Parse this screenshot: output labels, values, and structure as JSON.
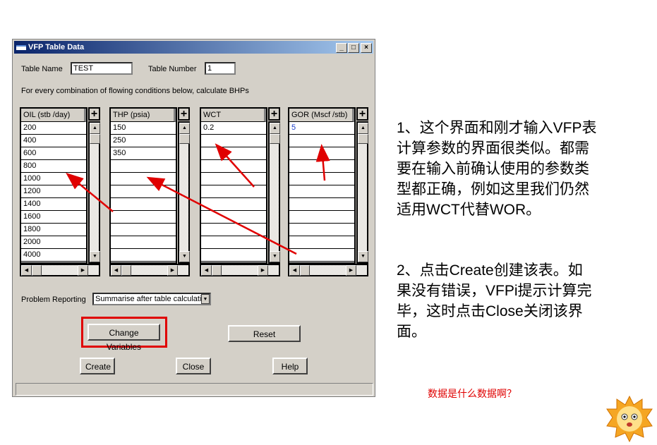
{
  "window": {
    "title": "VFP Table Data",
    "controls": [
      "_",
      "□",
      "×"
    ]
  },
  "table_name": {
    "label": "Table Name",
    "value": "TEST"
  },
  "table_number": {
    "label": "Table Number",
    "value": "1"
  },
  "instruction": "For every combination of flowing conditions below, calculate BHPs",
  "columns": [
    {
      "header": "OIL (stb /day)",
      "values": [
        "200",
        "400",
        "600",
        "800",
        "1000",
        "1200",
        "1400",
        "1600",
        "1800",
        "2000",
        "4000"
      ]
    },
    {
      "header": "THP (psia)",
      "values": [
        "150",
        "250",
        "350"
      ]
    },
    {
      "header": "WCT",
      "values": [
        "0.2"
      ]
    },
    {
      "header": "GOR (Mscf /stb)",
      "values": [
        "5"
      ]
    }
  ],
  "problem_reporting": {
    "label": "Problem Reporting",
    "value": "Summarise after table calculatio"
  },
  "buttons": {
    "change_variables": "Change Variables",
    "reset": "Reset",
    "create": "Create",
    "close": "Close",
    "help": "Help"
  },
  "notes": {
    "note1": [
      "1、这个界面和刚才输入VFP表",
      "计算参数的界面很类似。都需",
      "要在输入前确认使用的参数类",
      "型都正确，例如这里我们仍然",
      "适用WCT代替WOR。"
    ],
    "note2": [
      "2、点击Create创建该表。如",
      "果没有错误，VFPi提示计算完",
      "毕，这时点击Close关闭该界",
      "面。"
    ],
    "comment": "数据是什么数据啊？"
  },
  "colors": {
    "highlight": "#e00000",
    "titlebar": "#0a246a"
  }
}
